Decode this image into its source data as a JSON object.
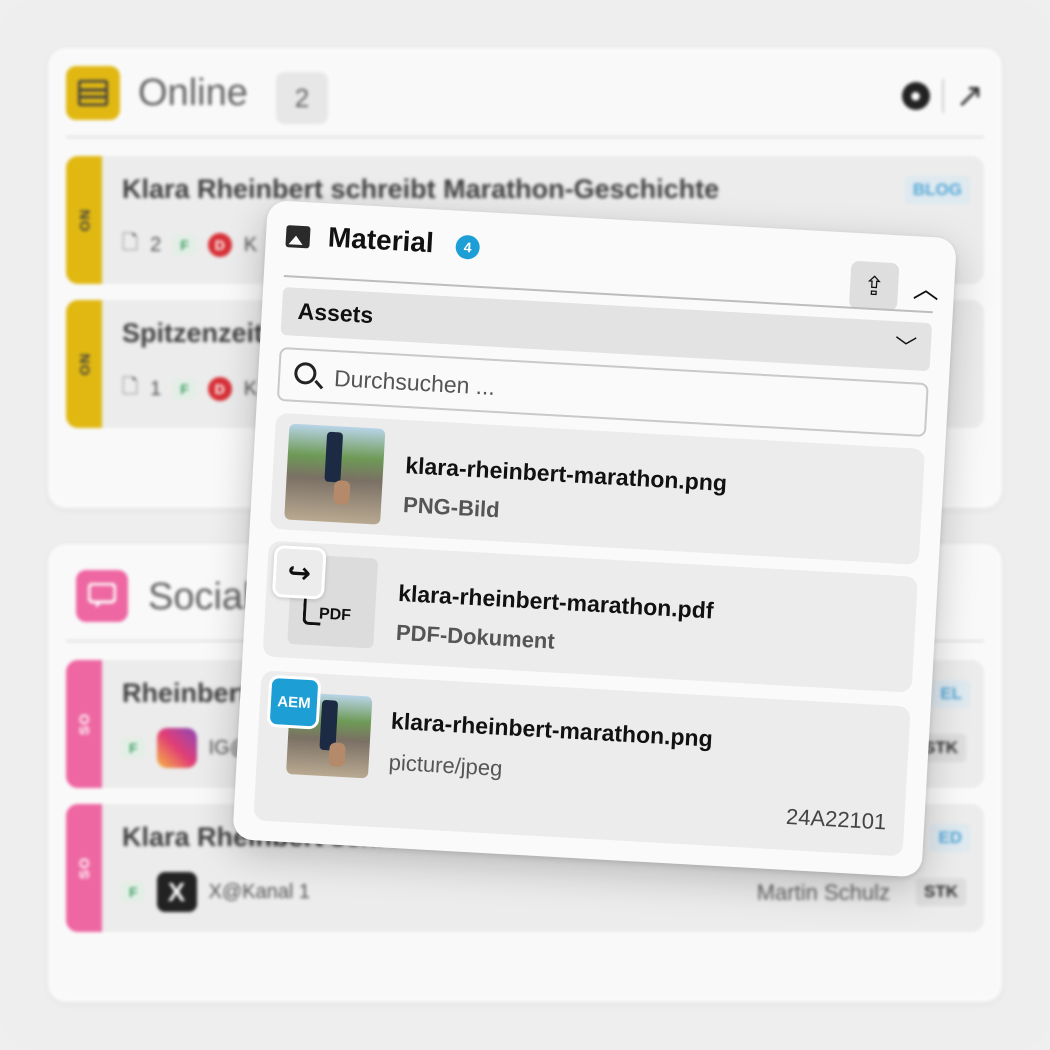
{
  "online": {
    "title": "Online",
    "count": "2",
    "rows": [
      {
        "tag": "ON",
        "title": "Klara Rheinbert schreibt Marathon-Geschichte",
        "type": "BLOG",
        "files": "2",
        "flag": "F",
        "dchip": "D",
        "author_initial": "K"
      },
      {
        "tag": "ON",
        "title": "Spitzenzeit",
        "files": "1",
        "flag": "F",
        "dchip": "D",
        "author_initial": "K"
      }
    ]
  },
  "social": {
    "title": "Social",
    "rows": [
      {
        "tag": "SO",
        "title": "Rheinbert",
        "flag": "F",
        "channel": "IG@",
        "badge": "STK",
        "type_fragment": "EL"
      },
      {
        "tag": "SO",
        "title": "Klara Rheinbert schreibt Marathon-Gesch",
        "flag": "F",
        "channel": "X@Kanal 1",
        "author": "Martin Schulz",
        "badge": "STK",
        "type_fragment": "ED"
      }
    ]
  },
  "material": {
    "title": "Material",
    "count": "4",
    "section": "Assets",
    "search_placeholder": "Durchsuchen ...",
    "assets": [
      {
        "name": "klara-rheinbert-marathon.png",
        "type": "PNG-Bild"
      },
      {
        "name": "klara-rheinbert-marathon.pdf",
        "type": "PDF-Dokument",
        "thumb_label": "PDF"
      },
      {
        "name": "klara-rheinbert-marathon.png",
        "type": "picture/jpeg",
        "badge": "AEM",
        "code": "24A22101"
      }
    ]
  },
  "colors": {
    "online_accent": "#e0b400",
    "social_accent": "#ef5c9c",
    "info_blue": "#1d9fd6"
  },
  "icons": [
    "grid-icon",
    "image-icon",
    "upload-icon",
    "chevron-up-icon",
    "chevron-down-icon",
    "search-icon",
    "share-icon",
    "external-link-icon",
    "record-icon"
  ]
}
